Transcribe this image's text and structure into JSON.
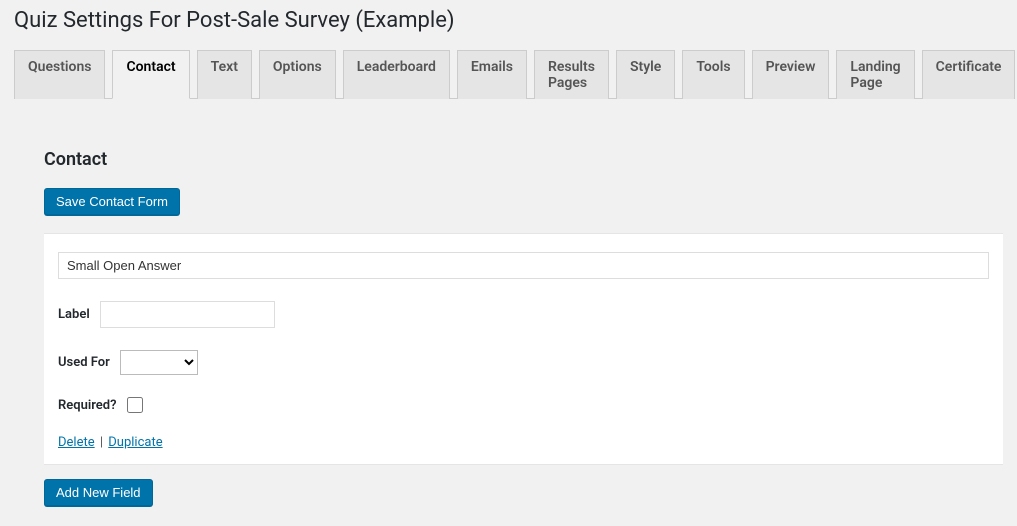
{
  "page": {
    "title": "Quiz Settings For Post-Sale Survey (Example)"
  },
  "tabs": [
    {
      "label": "Questions",
      "active": false
    },
    {
      "label": "Contact",
      "active": true
    },
    {
      "label": "Text",
      "active": false
    },
    {
      "label": "Options",
      "active": false
    },
    {
      "label": "Leaderboard",
      "active": false
    },
    {
      "label": "Emails",
      "active": false
    },
    {
      "label": "Results Pages",
      "active": false
    },
    {
      "label": "Style",
      "active": false
    },
    {
      "label": "Tools",
      "active": false
    },
    {
      "label": "Preview",
      "active": false
    },
    {
      "label": "Landing Page",
      "active": false
    },
    {
      "label": "Certificate",
      "active": false
    }
  ],
  "section": {
    "title": "Contact",
    "save_button": "Save Contact Form",
    "add_button": "Add New Field"
  },
  "field": {
    "type_value": "Small Open Answer",
    "label_label": "Label",
    "label_value": "",
    "usedfor_label": "Used For",
    "usedfor_value": "",
    "required_label": "Required?",
    "delete": "Delete",
    "duplicate": "Duplicate",
    "sep": " | "
  }
}
